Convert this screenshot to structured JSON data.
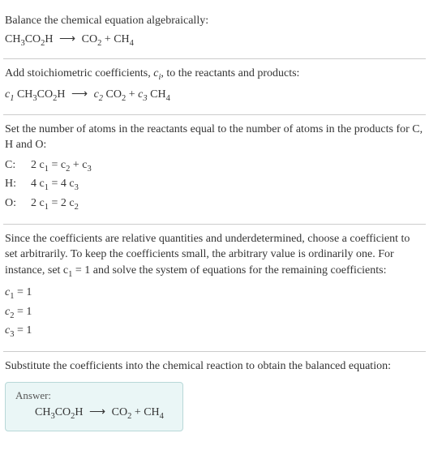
{
  "section1": {
    "prompt": "Balance the chemical equation algebraically:"
  },
  "section2": {
    "prompt": "Add stoichiometric coefficients, ",
    "prompt2": ", to the reactants and products:"
  },
  "section3": {
    "prompt": "Set the number of atoms in the reactants equal to the number of atoms in the products for C, H and O:",
    "rows": [
      {
        "el": "C:",
        "lhs": "2 c",
        "lsub": "1",
        "mid": " = c",
        "msub": "2",
        "plus": " + c",
        "rsub": "3"
      },
      {
        "el": "H:",
        "lhs": "4 c",
        "lsub": "1",
        "mid": " = 4 c",
        "msub": "3",
        "plus": "",
        "rsub": ""
      },
      {
        "el": "O:",
        "lhs": "2 c",
        "lsub": "1",
        "mid": " = 2 c",
        "msub": "2",
        "plus": "",
        "rsub": ""
      }
    ]
  },
  "section4": {
    "prompt": "Since the coefficients are relative quantities and underdetermined, choose a coefficient to set arbitrarily. To keep the coefficients small, the arbitrary value is ordinarily one. For instance, set c",
    "prompt_sub": "1",
    "prompt2": " = 1 and solve the system of equations for the remaining coefficients:",
    "coefs": [
      {
        "c": "c",
        "sub": "1",
        "val": " = 1"
      },
      {
        "c": "c",
        "sub": "2",
        "val": " = 1"
      },
      {
        "c": "c",
        "sub": "3",
        "val": " = 1"
      }
    ]
  },
  "section5": {
    "prompt": "Substitute the coefficients into the chemical reaction to obtain the balanced equation:",
    "answer_label": "Answer:"
  },
  "chem": {
    "ch3": "CH",
    "ch3_sub": "3",
    "co2h": "CO",
    "co2h_sub": "2",
    "h": "H",
    "arrow": "⟶",
    "co2": "CO",
    "co2_sub": "2",
    "plus": " + ",
    "ch4": "CH",
    "ch4_sub": "4",
    "c": "c",
    "sub_i": "i",
    "c1": "1",
    "c2": "2",
    "c3": "3",
    "space": " "
  }
}
